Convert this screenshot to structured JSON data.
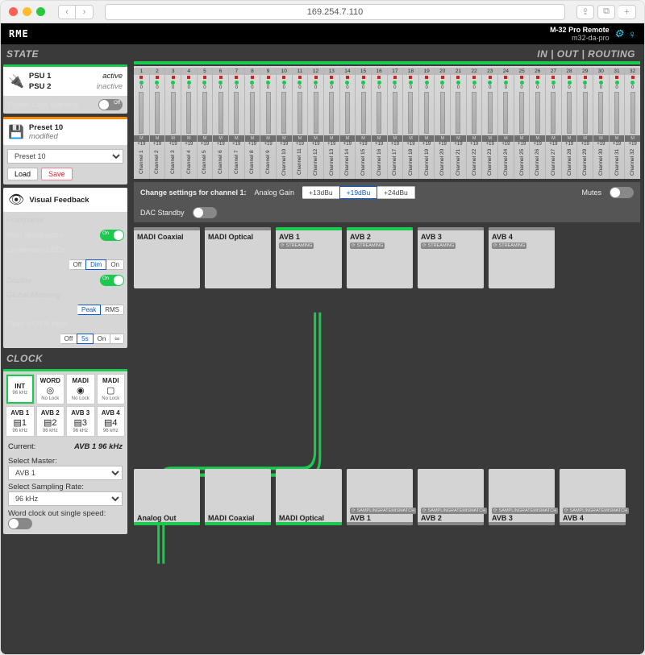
{
  "browser": {
    "url": "169.254.7.110"
  },
  "header": {
    "brand": "RME",
    "product": "M-32 Pro Remote",
    "device": "m32-da-pro"
  },
  "sidebar": {
    "state_title": "STATE",
    "psu": {
      "psu1_label": "PSU 1",
      "psu1_status": "active",
      "psu2_label": "PSU 2",
      "psu2_status": "inactive"
    },
    "plw_label": "Power Loss Warning",
    "plw_toggle": "Off",
    "preset": {
      "name": "Preset 10",
      "status": "modified",
      "select_value": "Preset 10",
      "load": "Load",
      "save": "Save"
    },
    "visual_feedback": {
      "title": "Visual Feedback",
      "frontpanel": "Frontpanel",
      "ring": "Ring Illumination",
      "ring_toggle": "On",
      "levelmeter": "Levelmeter LEDs",
      "lm_opts": [
        "Off",
        "Dim",
        "On"
      ],
      "lm_active": "Dim",
      "display": "Display",
      "display_toggle": "On",
      "global_metering": "Global Metering",
      "gm_opts": [
        "Peak",
        "RMS"
      ],
      "gm_active": "Peak",
      "peak_hold": "Peak + OVR Hold",
      "ph_opts": [
        "Off",
        "5s",
        "On",
        "∞"
      ],
      "ph_active": "5s"
    },
    "clock": {
      "title": "CLOCK",
      "sources_row1": [
        {
          "name": "INT",
          "sub": "96 kHz"
        },
        {
          "name": "WORD",
          "sub": "No Lock",
          "icon": "◎"
        },
        {
          "name": "MADI",
          "sub": "No Lock",
          "icon": "◉"
        },
        {
          "name": "MADI",
          "sub": "No Lock",
          "icon": "▢"
        }
      ],
      "sources_row2": [
        {
          "name": "AVB 1",
          "sub": "96 kHz",
          "icon": "▤1"
        },
        {
          "name": "AVB 2",
          "sub": "96 kHz",
          "icon": "▤2"
        },
        {
          "name": "AVB 3",
          "sub": "96 kHz",
          "icon": "▤3"
        },
        {
          "name": "AVB 4",
          "sub": "96 kHz",
          "icon": "▤4"
        }
      ],
      "current_label": "Current:",
      "current_value": "AVB 1 96 kHz",
      "master_label": "Select Master:",
      "master_value": "AVB 1",
      "rate_label": "Select Sampling Rate:",
      "rate_value": "96 kHz",
      "wcoss_label": "Word clock out single speed:"
    }
  },
  "main": {
    "title": "IN | OUT | ROUTING",
    "channel_count": 32,
    "channel_prefix": "Channel ",
    "channel_gain": "+19",
    "channel_mute": "M",
    "channel_led": "0",
    "settings": {
      "label": "Change settings for channel 1:",
      "analog_gain_label": "Analog Gain",
      "gain_opts": [
        "+13dBu",
        "+19dBu",
        "+24dBu"
      ],
      "gain_active": "+19dBu",
      "mutes_label": "Mutes",
      "dac_label": "DAC Standby"
    },
    "inputs": [
      {
        "name": "MADI Coaxial",
        "active": false,
        "badge": ""
      },
      {
        "name": "MADI Optical",
        "active": false,
        "badge": ""
      },
      {
        "name": "AVB 1",
        "active": true,
        "badge": "STREAMING"
      },
      {
        "name": "AVB 2",
        "active": true,
        "badge": "STREAMING"
      },
      {
        "name": "AVB 3",
        "active": false,
        "badge": "STREAMING"
      },
      {
        "name": "AVB 4",
        "active": false,
        "badge": "STREAMING"
      }
    ],
    "outputs": [
      {
        "name": "Analog Out",
        "active": true,
        "badge": ""
      },
      {
        "name": "MADI Coaxial",
        "active": true,
        "badge": ""
      },
      {
        "name": "MADI Optical",
        "active": true,
        "badge": ""
      },
      {
        "name": "AVB 1",
        "active": false,
        "badge": "SAMPLINGRATEMISMATCH"
      },
      {
        "name": "AVB 2",
        "active": false,
        "badge": "SAMPLINGRATEMISMATCH"
      },
      {
        "name": "AVB 3",
        "active": false,
        "badge": "SAMPLINGRATEMISMATCH"
      },
      {
        "name": "AVB 4",
        "active": false,
        "badge": "SAMPLINGRATEMISMATCH"
      }
    ]
  }
}
